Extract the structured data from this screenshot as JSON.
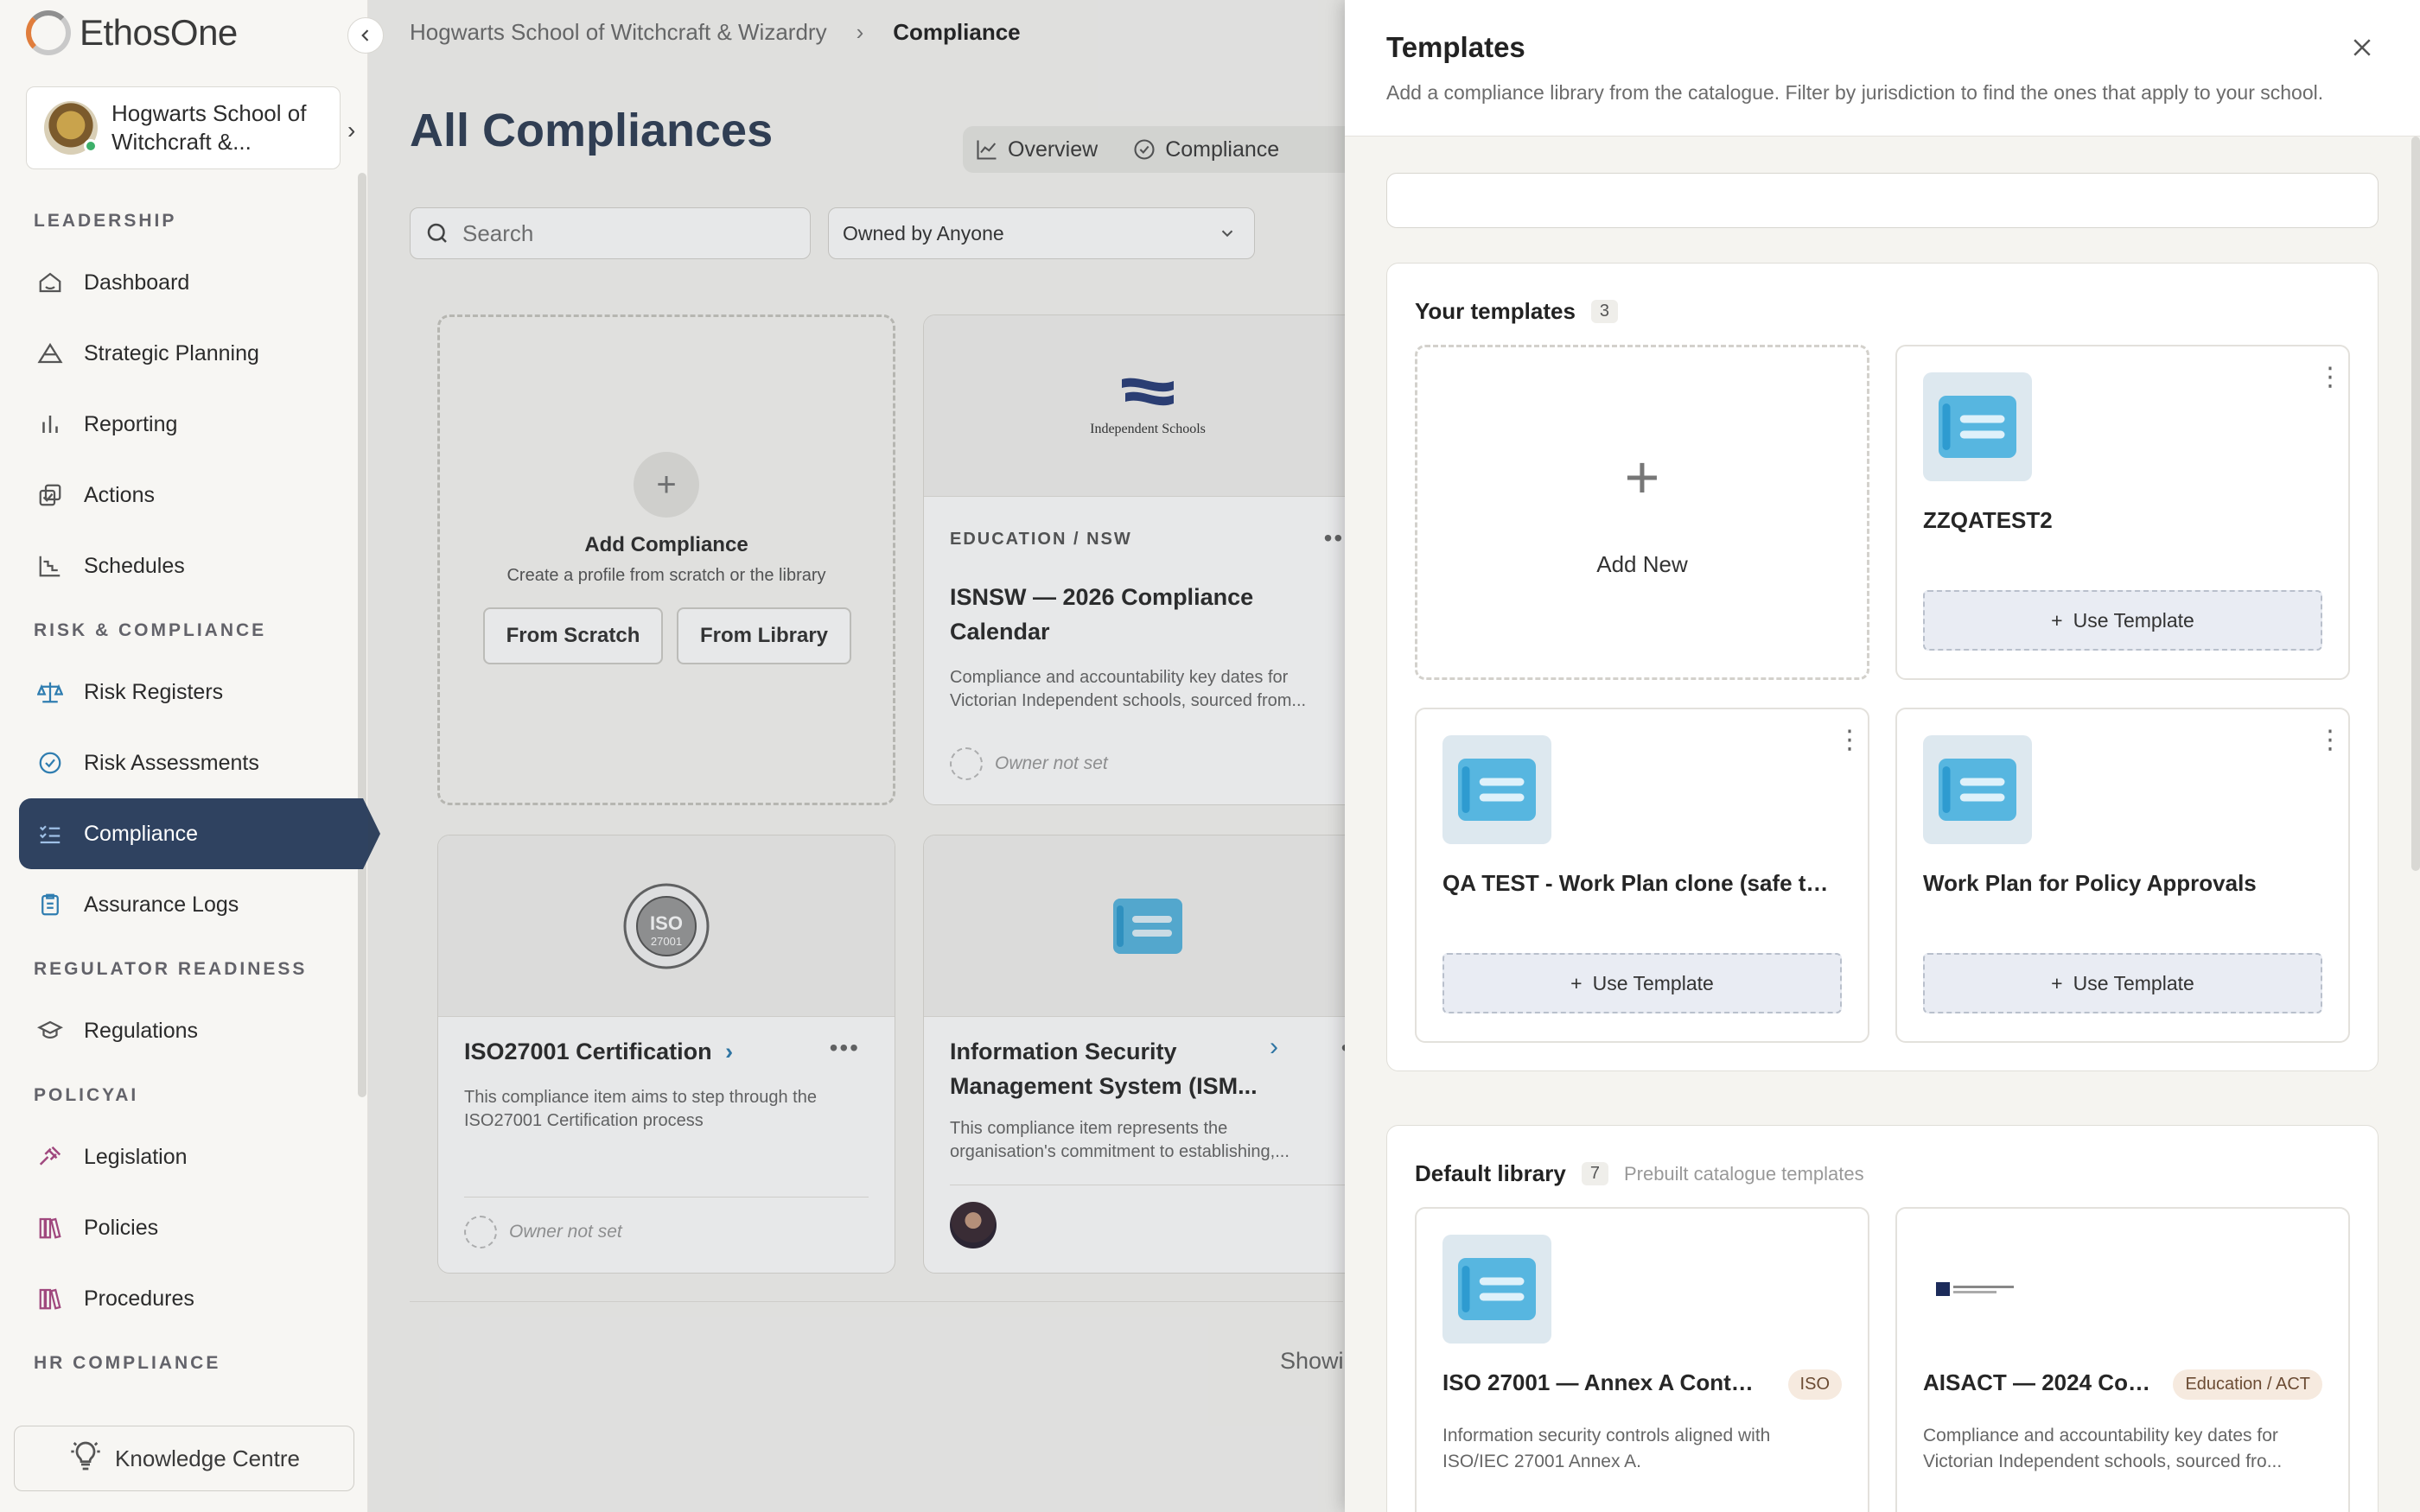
{
  "app": {
    "name": "EthosOne"
  },
  "org": {
    "name": "Hogwarts School of Witchcraft &..."
  },
  "sidebar": {
    "sections": [
      {
        "title": "LEADERSHIP",
        "items": [
          {
            "label": "Dashboard",
            "icon": "home-icon"
          },
          {
            "label": "Strategic Planning",
            "icon": "mountain-icon"
          },
          {
            "label": "Reporting",
            "icon": "bar-chart-icon"
          },
          {
            "label": "Actions",
            "icon": "check-copy-icon"
          },
          {
            "label": "Schedules",
            "icon": "stair-chart-icon"
          }
        ]
      },
      {
        "title": "RISK & COMPLIANCE",
        "items": [
          {
            "label": "Risk Registers",
            "icon": "scale-icon"
          },
          {
            "label": "Risk Assessments",
            "icon": "check-circle-icon"
          },
          {
            "label": "Compliance",
            "icon": "checklist-icon",
            "active": true
          },
          {
            "label": "Assurance Logs",
            "icon": "clipboard-icon"
          }
        ]
      },
      {
        "title": "REGULATOR READINESS",
        "items": [
          {
            "label": "Regulations",
            "icon": "graduation-cap-icon"
          }
        ]
      },
      {
        "title": "POLICYAI",
        "items": [
          {
            "label": "Legislation",
            "icon": "gavel-icon"
          },
          {
            "label": "Policies",
            "icon": "books-icon"
          },
          {
            "label": "Procedures",
            "icon": "books-icon"
          }
        ]
      },
      {
        "title": "HR COMPLIANCE",
        "items": []
      }
    ],
    "knowledge_centre": "Knowledge Centre"
  },
  "breadcrumb": {
    "org": "Hogwarts School of Witchcraft & Wizardry",
    "current": "Compliance"
  },
  "main": {
    "title": "All Compliances",
    "tabs": [
      "Overview",
      "Compliance"
    ],
    "search_placeholder": "Search",
    "owner_filter": "Owned by Anyone",
    "add_card": {
      "title": "Add Compliance",
      "subtitle": "Create a profile from scratch or the library",
      "from_scratch": "From Scratch",
      "from_library": "From Library"
    },
    "cards": [
      {
        "kicker": "EDUCATION / NSW",
        "title_line1": "ISNSW — 2026 Compliance",
        "title_line2": "Calendar",
        "desc_line1": "Compliance and accountability key dates for",
        "desc_line2": "Victorian Independent schools, sourced from...",
        "owner": "Owner not set",
        "logo_text": "Independent Schools"
      },
      {
        "title": "ISO27001 Certification",
        "desc_line1": "This compliance item aims to step through the",
        "desc_line2": "ISO27001 Certification process",
        "owner": "Owner not set",
        "logo_text": "ISO 27001"
      },
      {
        "title_line1": "Information Security",
        "title_line2": "Management System (ISM...",
        "desc_line1": "This compliance item represents the",
        "desc_line2": "organisation's commitment to establishing,..."
      }
    ],
    "showing": "Showi"
  },
  "drawer": {
    "title": "Templates",
    "subtitle": "Add a compliance library from the catalogue. Filter by jurisdiction to find the ones that apply to your school.",
    "your_templates": {
      "title": "Your templates",
      "count": "3",
      "add_new": "Add New",
      "items": [
        {
          "name": "ZZQATEST2",
          "button": "Use Template"
        },
        {
          "name": "QA TEST - Work Plan clone (safe to d...",
          "button": "Use Template"
        },
        {
          "name": "Work Plan for Policy Approvals",
          "button": "Use Template"
        }
      ]
    },
    "default_library": {
      "title": "Default library",
      "count": "7",
      "hint": "Prebuilt catalogue templates",
      "items": [
        {
          "name": "ISO 27001 — Annex A Controls ...",
          "tag": "ISO",
          "desc": "Information security controls aligned with ISO/IEC 27001 Annex A."
        },
        {
          "name": "AISACT — 2024 Com...",
          "tag": "Education / ACT",
          "desc": "Compliance and accountability key dates for Victorian Independent schools, sourced fro..."
        }
      ]
    }
  },
  "colors": {
    "sidebar_active": "#2f4260",
    "accent_blue": "#3aa6d9",
    "icon_tile": "#dde8ef"
  }
}
